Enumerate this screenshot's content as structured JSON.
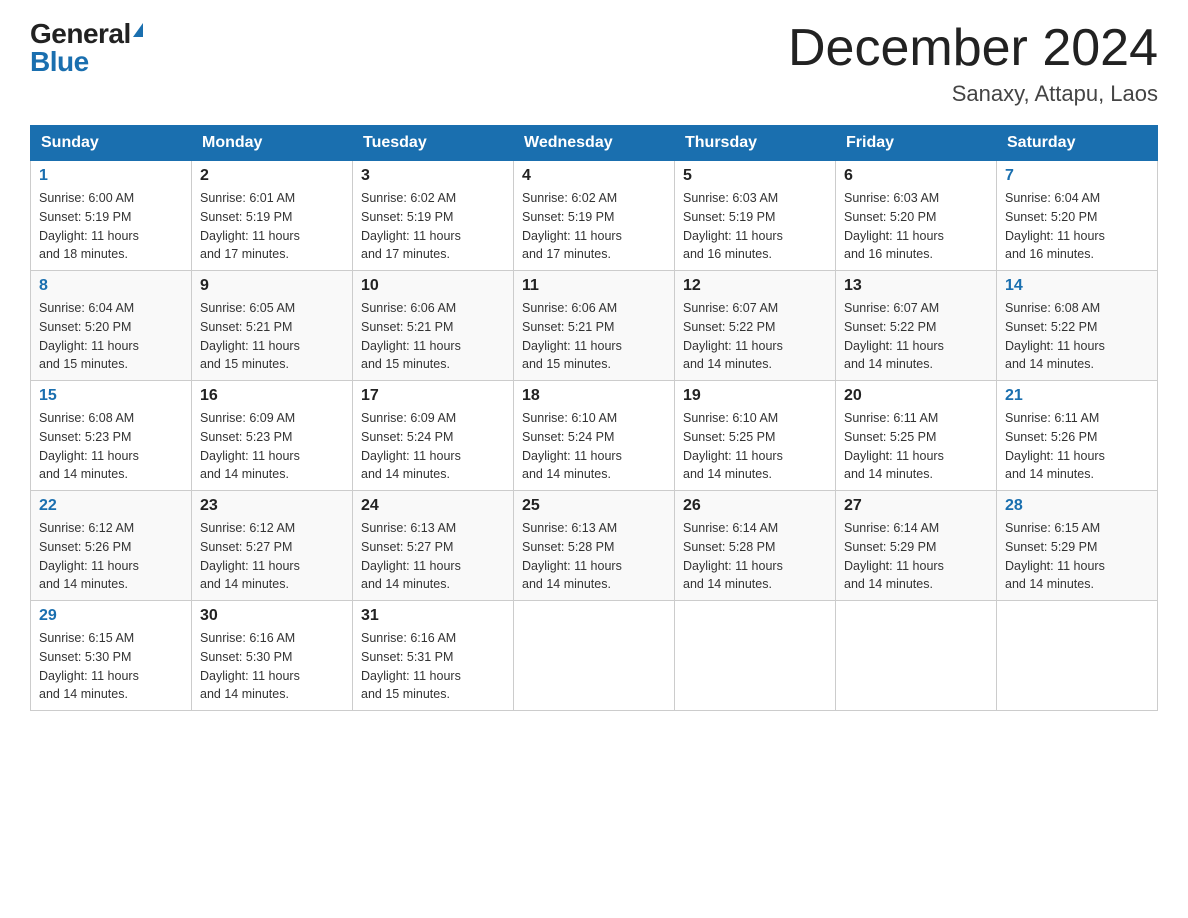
{
  "logo": {
    "general": "General",
    "blue": "Blue"
  },
  "title": "December 2024",
  "location": "Sanaxy, Attapu, Laos",
  "days_of_week": [
    "Sunday",
    "Monday",
    "Tuesday",
    "Wednesday",
    "Thursday",
    "Friday",
    "Saturday"
  ],
  "weeks": [
    [
      {
        "day": "1",
        "sunrise": "6:00 AM",
        "sunset": "5:19 PM",
        "daylight": "11 hours and 18 minutes."
      },
      {
        "day": "2",
        "sunrise": "6:01 AM",
        "sunset": "5:19 PM",
        "daylight": "11 hours and 17 minutes."
      },
      {
        "day": "3",
        "sunrise": "6:02 AM",
        "sunset": "5:19 PM",
        "daylight": "11 hours and 17 minutes."
      },
      {
        "day": "4",
        "sunrise": "6:02 AM",
        "sunset": "5:19 PM",
        "daylight": "11 hours and 17 minutes."
      },
      {
        "day": "5",
        "sunrise": "6:03 AM",
        "sunset": "5:19 PM",
        "daylight": "11 hours and 16 minutes."
      },
      {
        "day": "6",
        "sunrise": "6:03 AM",
        "sunset": "5:20 PM",
        "daylight": "11 hours and 16 minutes."
      },
      {
        "day": "7",
        "sunrise": "6:04 AM",
        "sunset": "5:20 PM",
        "daylight": "11 hours and 16 minutes."
      }
    ],
    [
      {
        "day": "8",
        "sunrise": "6:04 AM",
        "sunset": "5:20 PM",
        "daylight": "11 hours and 15 minutes."
      },
      {
        "day": "9",
        "sunrise": "6:05 AM",
        "sunset": "5:21 PM",
        "daylight": "11 hours and 15 minutes."
      },
      {
        "day": "10",
        "sunrise": "6:06 AM",
        "sunset": "5:21 PM",
        "daylight": "11 hours and 15 minutes."
      },
      {
        "day": "11",
        "sunrise": "6:06 AM",
        "sunset": "5:21 PM",
        "daylight": "11 hours and 15 minutes."
      },
      {
        "day": "12",
        "sunrise": "6:07 AM",
        "sunset": "5:22 PM",
        "daylight": "11 hours and 14 minutes."
      },
      {
        "day": "13",
        "sunrise": "6:07 AM",
        "sunset": "5:22 PM",
        "daylight": "11 hours and 14 minutes."
      },
      {
        "day": "14",
        "sunrise": "6:08 AM",
        "sunset": "5:22 PM",
        "daylight": "11 hours and 14 minutes."
      }
    ],
    [
      {
        "day": "15",
        "sunrise": "6:08 AM",
        "sunset": "5:23 PM",
        "daylight": "11 hours and 14 minutes."
      },
      {
        "day": "16",
        "sunrise": "6:09 AM",
        "sunset": "5:23 PM",
        "daylight": "11 hours and 14 minutes."
      },
      {
        "day": "17",
        "sunrise": "6:09 AM",
        "sunset": "5:24 PM",
        "daylight": "11 hours and 14 minutes."
      },
      {
        "day": "18",
        "sunrise": "6:10 AM",
        "sunset": "5:24 PM",
        "daylight": "11 hours and 14 minutes."
      },
      {
        "day": "19",
        "sunrise": "6:10 AM",
        "sunset": "5:25 PM",
        "daylight": "11 hours and 14 minutes."
      },
      {
        "day": "20",
        "sunrise": "6:11 AM",
        "sunset": "5:25 PM",
        "daylight": "11 hours and 14 minutes."
      },
      {
        "day": "21",
        "sunrise": "6:11 AM",
        "sunset": "5:26 PM",
        "daylight": "11 hours and 14 minutes."
      }
    ],
    [
      {
        "day": "22",
        "sunrise": "6:12 AM",
        "sunset": "5:26 PM",
        "daylight": "11 hours and 14 minutes."
      },
      {
        "day": "23",
        "sunrise": "6:12 AM",
        "sunset": "5:27 PM",
        "daylight": "11 hours and 14 minutes."
      },
      {
        "day": "24",
        "sunrise": "6:13 AM",
        "sunset": "5:27 PM",
        "daylight": "11 hours and 14 minutes."
      },
      {
        "day": "25",
        "sunrise": "6:13 AM",
        "sunset": "5:28 PM",
        "daylight": "11 hours and 14 minutes."
      },
      {
        "day": "26",
        "sunrise": "6:14 AM",
        "sunset": "5:28 PM",
        "daylight": "11 hours and 14 minutes."
      },
      {
        "day": "27",
        "sunrise": "6:14 AM",
        "sunset": "5:29 PM",
        "daylight": "11 hours and 14 minutes."
      },
      {
        "day": "28",
        "sunrise": "6:15 AM",
        "sunset": "5:29 PM",
        "daylight": "11 hours and 14 minutes."
      }
    ],
    [
      {
        "day": "29",
        "sunrise": "6:15 AM",
        "sunset": "5:30 PM",
        "daylight": "11 hours and 14 minutes."
      },
      {
        "day": "30",
        "sunrise": "6:16 AM",
        "sunset": "5:30 PM",
        "daylight": "11 hours and 14 minutes."
      },
      {
        "day": "31",
        "sunrise": "6:16 AM",
        "sunset": "5:31 PM",
        "daylight": "11 hours and 15 minutes."
      },
      null,
      null,
      null,
      null
    ]
  ],
  "sunrise_label": "Sunrise:",
  "sunset_label": "Sunset:",
  "daylight_label": "Daylight:"
}
